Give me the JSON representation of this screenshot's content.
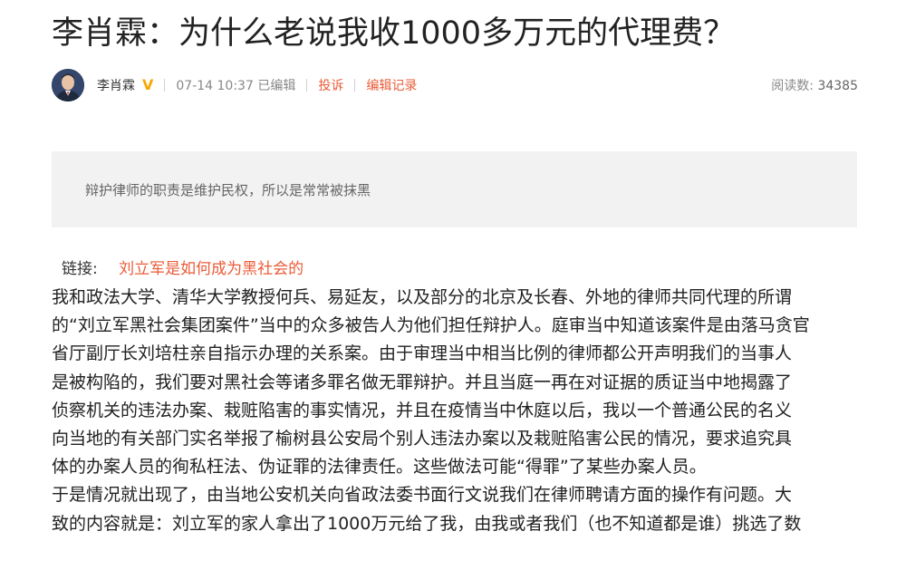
{
  "article": {
    "title": "李肖霖：为什么老说我收1000多万元的代理费？"
  },
  "meta": {
    "author": "李肖霖",
    "verified_badge": "V",
    "timestamp": "07-14 10:37 已编辑",
    "report_label": "投诉",
    "edit_history_label": "编辑记录",
    "read_label": "阅读数:",
    "read_count": "34385"
  },
  "summary": {
    "text": "辩护律师的职责是维护民权，所以是常常被抹黑"
  },
  "link": {
    "label": "链接:",
    "text": "刘立军是如何成为黑社会的"
  },
  "body": {
    "lines": [
      "我和政法大学、清华大学教授何兵、易延友，以及部分的北京及长春、外地的律师共同代理的所谓",
      "的“刘立军黑社会集团案件”当中的众多被告人为他们担任辩护人。庭审当中知道该案件是由落马贪官",
      "省厅副厅长刘培柱亲自指示办理的关系案。由于审理当中相当比例的律师都公开声明我们的当事人",
      "是被构陷的，我们要对黑社会等诸多罪名做无罪辩护。并且当庭一再在对证据的质证当中地揭露了",
      "侦察机关的违法办案、栽赃陷害的事实情况，并且在疫情当中休庭以后，我以一个普通公民的名义",
      "向当地的有关部门实名举报了榆树县公安局个别人违法办案以及栽赃陷害公民的情况，要求追究具",
      "体的办案人员的徇私枉法、伪证罪的法律责任。这些做法可能“得罪”了某些办案人员。",
      "于是情况就出现了，由当地公安机关向省政法委书面行文说我们在律师聘请方面的操作有问题。大",
      "致的内容就是：刘立军的家人拿出了1000万元给了我，由我或者我们（也不知道都是谁）挑选了数"
    ]
  },
  "colors": {
    "accent": "#eb5b37",
    "verify": "#f7a800",
    "summary_bg": "#f2f2f2"
  }
}
